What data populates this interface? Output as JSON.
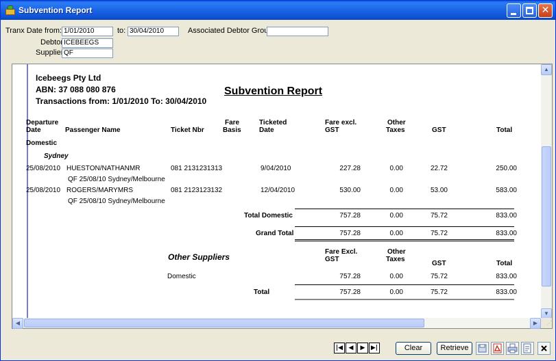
{
  "window": {
    "title": "Subvention Report"
  },
  "criteria": {
    "tranx_date_from_label": "Tranx Date from:",
    "tranx_date_from": "1/01/2010",
    "to_label": "to:",
    "tranx_date_to": "30/04/2010",
    "associated_debtor_group_label": "Associated Debtor Group:",
    "associated_debtor_group": "",
    "debtor_label": "Debtor:",
    "debtor": "ICEBEEGS",
    "supplier_label": "Supplier:",
    "supplier": "QF"
  },
  "report": {
    "company_name": "Icebeegs Pty Ltd",
    "abn": "ABN: 37 088 080 876",
    "transactions_range": "Transactions from: 1/01/2010 To: 30/04/2010",
    "title": "Subvention Report",
    "columns": {
      "departure_date_1": "Departure",
      "departure_date_2": "Date",
      "passenger_name": "Passenger Name",
      "ticket_nbr": "Ticket Nbr",
      "fare_basis_1": "Fare",
      "fare_basis_2": "Basis",
      "ticketed_date_1": "Ticketed",
      "ticketed_date_2": "Date",
      "fare_excl_gst_1": "Fare excl.",
      "fare_excl_gst_2": "GST",
      "other_taxes_1": "Other",
      "other_taxes_2": "Taxes",
      "gst": "GST",
      "total": "Total"
    },
    "group": "Domestic",
    "subgroup": "Sydney",
    "rows": [
      {
        "departure_date": "25/08/2010",
        "passenger": "HUESTON/NATHANMR",
        "ticket_nbr": "081  2131231313",
        "ticketed_date": "9/04/2010",
        "fare_excl_gst": "227.28",
        "other_taxes": "0.00",
        "gst": "22.72",
        "total": "250.00",
        "detail": "QF   25/08/10 Sydney/Melbourne"
      },
      {
        "departure_date": "25/08/2010",
        "passenger": "ROGERS/MARYMRS",
        "ticket_nbr": "081  2123123132",
        "ticketed_date": "12/04/2010",
        "fare_excl_gst": "530.00",
        "other_taxes": "0.00",
        "gst": "53.00",
        "total": "583.00",
        "detail": "QF   25/08/10 Sydney/Melbourne"
      }
    ],
    "total_domestic": {
      "label": "Total Domestic",
      "fare_excl_gst": "757.28",
      "other_taxes": "0.00",
      "gst": "75.72",
      "total": "833.00"
    },
    "grand_total": {
      "label": "Grand Total",
      "fare_excl_gst": "757.28",
      "other_taxes": "0.00",
      "gst": "75.72",
      "total": "833.00"
    },
    "other_suppliers": {
      "title": "Other Suppliers",
      "columns": {
        "fare_excl_gst_1": "Fare Excl.",
        "fare_excl_gst_2": "GST",
        "other_taxes_1": "Other",
        "other_taxes_2": "Taxes",
        "gst": "GST",
        "total": "Total"
      },
      "row": {
        "label": "Domestic",
        "fare_excl_gst": "757.28",
        "other_taxes": "0.00",
        "gst": "75.72",
        "total": "833.00"
      },
      "total": {
        "label": "Total",
        "fare_excl_gst": "757.28",
        "other_taxes": "0.00",
        "gst": "75.72",
        "total": "833.00"
      }
    }
  },
  "toolbar": {
    "nav": {
      "first": "|◀",
      "prev": "◀",
      "next": "▶",
      "last": "▶|"
    },
    "clear_label": "Clear",
    "retrieve_label": "Retrieve",
    "icons": [
      "save-icon",
      "pdf-icon",
      "print-icon",
      "preview-icon",
      "close-icon"
    ]
  },
  "colors": {
    "titlebar": "#0a5bde",
    "margin_line": "#7b7bd6",
    "scroll_thumb": "#c8d6fb",
    "window_bg": "#ece9d8"
  }
}
